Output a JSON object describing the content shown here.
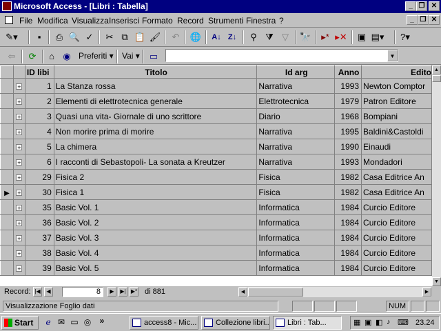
{
  "window": {
    "title": "Microsoft Access - [Libri : Tabella]"
  },
  "menu": {
    "items": [
      {
        "label": "File"
      },
      {
        "label": "Modifica"
      },
      {
        "label": "Visualizza"
      },
      {
        "label": "Inserisci"
      },
      {
        "label": "Formato"
      },
      {
        "label": "Record"
      },
      {
        "label": "Strumenti"
      },
      {
        "label": "Finestra"
      },
      {
        "label": "?"
      }
    ]
  },
  "web_toolbar": {
    "favorites_label": "Preferiti",
    "go_label": "Vai",
    "address_value": ""
  },
  "table": {
    "columns": [
      "ID libi",
      "Titolo",
      "Id arg",
      "Anno",
      "Edito"
    ],
    "current_row_index": 7,
    "rows": [
      {
        "id": "1",
        "titolo": "La Stanza rossa",
        "arg": "Narrativa",
        "anno": "1993",
        "editore": "Newton Comptor"
      },
      {
        "id": "2",
        "titolo": "Elementi di elettrotecnica generale",
        "arg": "Elettrotecnica",
        "anno": "1979",
        "editore": "Patron Editore"
      },
      {
        "id": "3",
        "titolo": "Quasi una vita- Giornale di uno scrittore",
        "arg": "Diario",
        "anno": "1968",
        "editore": "Bompiani"
      },
      {
        "id": "4",
        "titolo": "Non morire prima di morire",
        "arg": "Narrativa",
        "anno": "1995",
        "editore": "Baldini&Castoldi"
      },
      {
        "id": "5",
        "titolo": "La chimera",
        "arg": "Narrativa",
        "anno": "1990",
        "editore": "Einaudi"
      },
      {
        "id": "6",
        "titolo": "I racconti di Sebastopoli- La sonata a Kreutzer",
        "arg": "Narrativa",
        "anno": "1993",
        "editore": "Mondadori"
      },
      {
        "id": "29",
        "titolo": "Fisica 2",
        "arg": "Fisica",
        "anno": "1982",
        "editore": "Casa Editrice An"
      },
      {
        "id": "30",
        "titolo": "Fisica 1",
        "arg": "Fisica",
        "anno": "1982",
        "editore": "Casa Editrice An"
      },
      {
        "id": "35",
        "titolo": "Basic Vol. 1",
        "arg": "Informatica",
        "anno": "1984",
        "editore": "Curcio Editore"
      },
      {
        "id": "36",
        "titolo": "Basic Vol. 2",
        "arg": "Informatica",
        "anno": "1984",
        "editore": "Curcio Editore"
      },
      {
        "id": "37",
        "titolo": "Basic Vol. 3",
        "arg": "Informatica",
        "anno": "1984",
        "editore": "Curcio Editore"
      },
      {
        "id": "38",
        "titolo": "Basic Vol. 4",
        "arg": "Informatica",
        "anno": "1984",
        "editore": "Curcio Editore"
      },
      {
        "id": "39",
        "titolo": "Basic Vol. 5",
        "arg": "Informatica",
        "anno": "1984",
        "editore": "Curcio Editore"
      }
    ]
  },
  "record_nav": {
    "label": "Record:",
    "current": "8",
    "total_text": "di 881"
  },
  "status": {
    "text": "Visualizzazione Foglio dati",
    "num_indicator": "NUM"
  },
  "taskbar": {
    "start_label": "Start",
    "quicklaunch_chevron": "»",
    "buttons": [
      {
        "label": "access8 - Mic..."
      },
      {
        "label": "Collezione libri..."
      },
      {
        "label": "Libri : Tab..."
      }
    ],
    "clock": "23.24"
  }
}
